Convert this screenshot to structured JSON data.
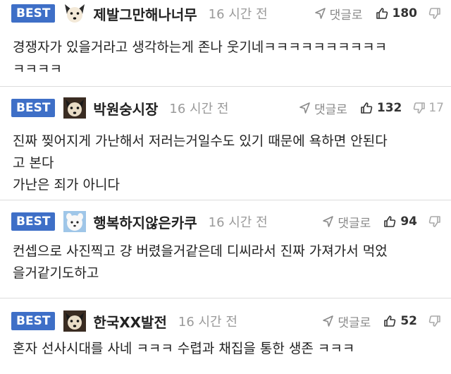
{
  "comments": [
    {
      "badge": "BEST",
      "nickname": "제발그만해나너무",
      "time": "16 시간 전",
      "reply_label": "댓글로",
      "likes": "180",
      "dislikes": "",
      "avatar": "dog-avatar-icon",
      "lines": [
        "경쟁자가 있을거라고 생각하는게 존나 웃기네ㅋㅋㅋㅋㅋㅋㅋㅋㅋㅋ",
        "ㅋㅋㅋㅋ"
      ]
    },
    {
      "badge": "BEST",
      "nickname": "박원숭시장",
      "time": "16 시간 전",
      "reply_label": "댓글로",
      "likes": "132",
      "dislikes": "17",
      "avatar": "dog-avatar-icon",
      "lines": [
        "진짜 찢어지게 가난해서 저러는거일수도 있기 때문에 욕하면 안된다",
        "고 본다",
        "가난은 죄가 아니다"
      ]
    },
    {
      "badge": "BEST",
      "nickname": "행복하지않은카쿠",
      "time": "16 시간 전",
      "reply_label": "댓글로",
      "likes": "94",
      "dislikes": "",
      "avatar": "dog-avatar-icon",
      "lines": [
        "컨셉으로 사진찍고 걍 버렸을거같은데 디씨라서 진짜 가져가서 먹었",
        "을거같기도하고"
      ]
    },
    {
      "badge": "BEST",
      "nickname": "한국XX발전",
      "time": "16 시간 전",
      "reply_label": "댓글로",
      "likes": "52",
      "dislikes": "",
      "avatar": "dog-avatar-icon",
      "lines": [
        "혼자 선사시대를 사네 ㅋㅋㅋ 수렵과 채집을 통한 생존 ㅋㅋㅋ"
      ]
    }
  ],
  "colors": {
    "badge": "#3e6fc7",
    "divider": "#dcdcdc",
    "meta": "#9a9a9a"
  }
}
